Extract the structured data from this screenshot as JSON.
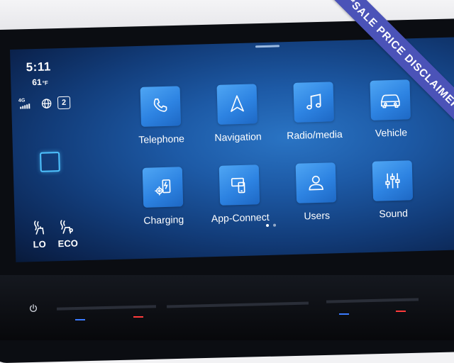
{
  "status": {
    "time": "5:11",
    "temperature": "61",
    "temperature_unit": "°F",
    "network": "4G",
    "badge_count": "2"
  },
  "apps": [
    {
      "label": "Telephone",
      "icon": "phone-icon"
    },
    {
      "label": "Navigation",
      "icon": "navigation-arrow-icon"
    },
    {
      "label": "Radio/media",
      "icon": "music-note-icon"
    },
    {
      "label": "Vehicle",
      "icon": "car-icon"
    },
    {
      "label": "Charging",
      "icon": "charging-icon"
    },
    {
      "label": "App-Connect",
      "icon": "app-connect-icon"
    },
    {
      "label": "Users",
      "icon": "user-icon"
    },
    {
      "label": "Sound",
      "icon": "equalizer-icon"
    }
  ],
  "seats": {
    "left_label": "LO",
    "right_label": "ECO"
  },
  "pagination": {
    "current": 1,
    "total": 2
  },
  "banner": {
    "text": "*SALE PRICE DISCLAIMER"
  },
  "colors": {
    "screen_accent": "#2a74c4",
    "icon_tile": "#3a8fe9",
    "banner": "#4b53b8",
    "home_square": "#4fc3ff"
  }
}
